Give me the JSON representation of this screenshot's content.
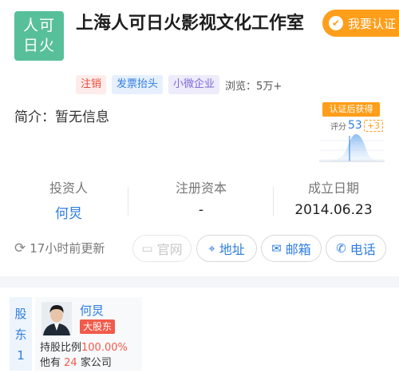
{
  "header": {
    "logo_line1": "人可",
    "logo_line2": "日火",
    "company_name": "上海人可日火影视文化工作室",
    "claim_button": "我要认证"
  },
  "tags": {
    "status": "注销",
    "invoice": "发票抬头",
    "scale": "小微企业",
    "views": "浏览：5万+"
  },
  "intro": "简介：暂无信息",
  "score": {
    "badge": "认证后获得",
    "label": "评分",
    "value": "53",
    "plus": "+3"
  },
  "stats": {
    "investor_label": "投资人",
    "investor_value": "何炅",
    "capital_label": "注册资本",
    "capital_value": "-",
    "founded_label": "成立日期",
    "founded_value": "2014.06.23"
  },
  "actions": {
    "update_text": "17小时前更新",
    "website": "官网",
    "address": "地址",
    "email": "邮箱",
    "phone": "电话"
  },
  "shareholder": {
    "section_label": "股东",
    "count": "1",
    "name": "何炅",
    "badge": "大股东",
    "ratio_label": "持股比例",
    "ratio_value": "100.00%",
    "companies_prefix": "他有",
    "companies_count": "24",
    "companies_suffix": "家公司"
  },
  "colors": {
    "brand_blue": "#2e7ddf",
    "accent_orange": "#ff9e1a",
    "logo_green": "#58bf9b",
    "alert_red": "#f25a4a"
  },
  "icons": [
    "check-circle-icon",
    "refresh-icon",
    "monitor-icon",
    "location-pin-icon",
    "envelope-icon",
    "phone-icon",
    "avatar-person"
  ]
}
